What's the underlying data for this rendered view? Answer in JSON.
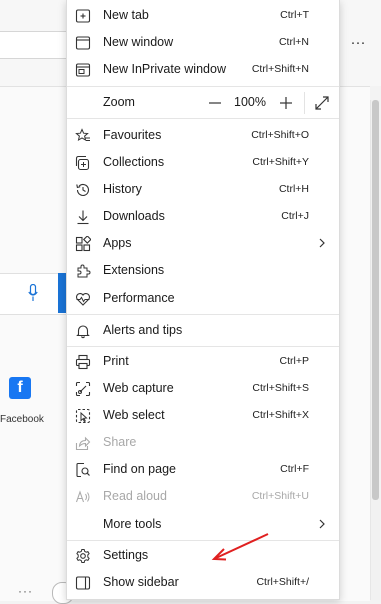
{
  "menu": {
    "items": [
      {
        "label": "New tab",
        "shortcut": "Ctrl+T"
      },
      {
        "label": "New window",
        "shortcut": "Ctrl+N"
      },
      {
        "label": "New InPrivate window",
        "shortcut": "Ctrl+Shift+N"
      },
      {
        "label": "Favourites",
        "shortcut": "Ctrl+Shift+O"
      },
      {
        "label": "Collections",
        "shortcut": "Ctrl+Shift+Y"
      },
      {
        "label": "History",
        "shortcut": "Ctrl+H"
      },
      {
        "label": "Downloads",
        "shortcut": "Ctrl+J"
      },
      {
        "label": "Apps",
        "shortcut": ""
      },
      {
        "label": "Extensions",
        "shortcut": ""
      },
      {
        "label": "Performance",
        "shortcut": ""
      },
      {
        "label": "Alerts and tips",
        "shortcut": ""
      },
      {
        "label": "Print",
        "shortcut": "Ctrl+P"
      },
      {
        "label": "Web capture",
        "shortcut": "Ctrl+Shift+S"
      },
      {
        "label": "Web select",
        "shortcut": "Ctrl+Shift+X"
      },
      {
        "label": "Share",
        "shortcut": ""
      },
      {
        "label": "Find on page",
        "shortcut": "Ctrl+F"
      },
      {
        "label": "Read aloud",
        "shortcut": "Ctrl+Shift+U"
      },
      {
        "label": "More tools",
        "shortcut": ""
      },
      {
        "label": "Settings",
        "shortcut": ""
      },
      {
        "label": "Show sidebar",
        "shortcut": "Ctrl+Shift+/"
      }
    ],
    "zoom": {
      "label": "Zoom",
      "value": "100%"
    }
  },
  "background": {
    "more_button": "···",
    "shortcut_label": "Facebook",
    "shortcut_icon": "f",
    "bottom_dots": "···"
  },
  "colors": {
    "accent": "#1a73d6",
    "annotation_arrow": "#e02020",
    "facebook": "#1877f2"
  }
}
